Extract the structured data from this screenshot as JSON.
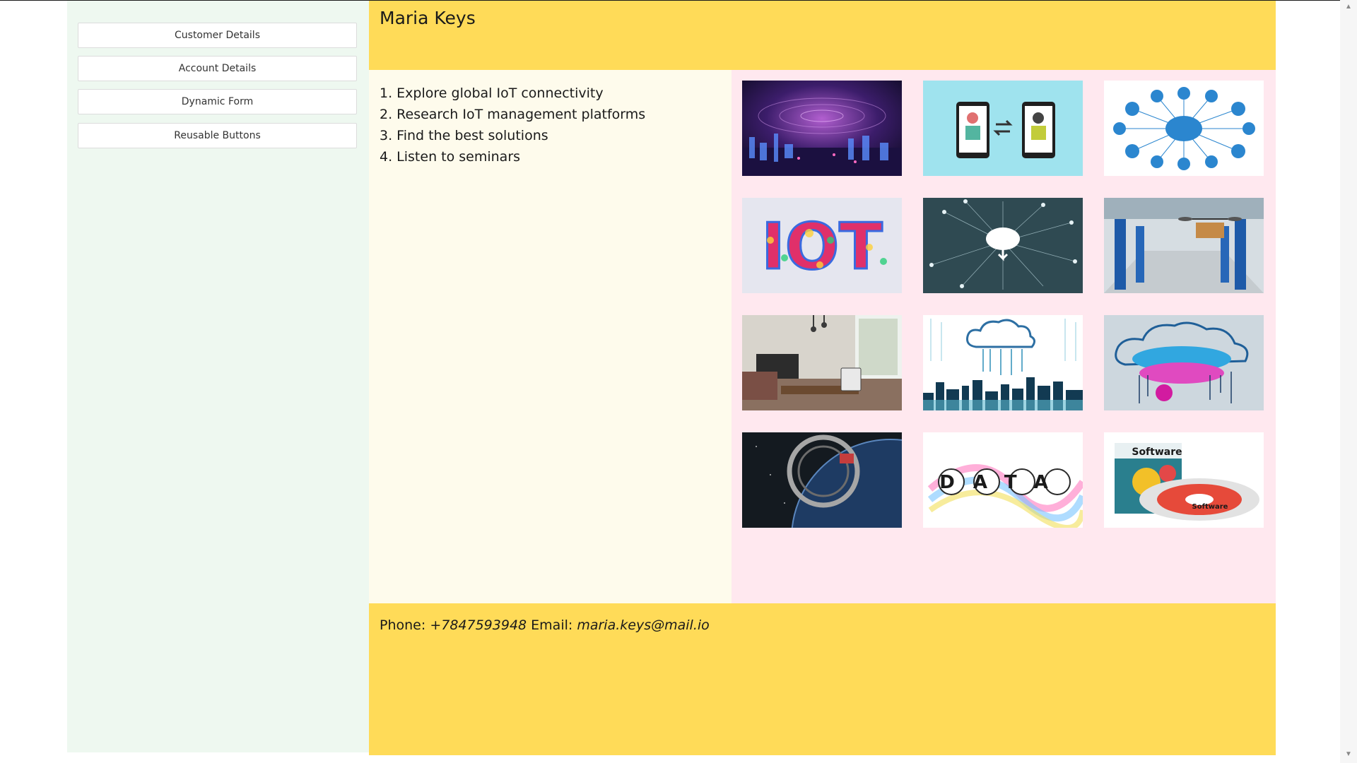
{
  "sidebar": {
    "buttons": [
      {
        "label": "Customer Details"
      },
      {
        "label": "Account Details"
      },
      {
        "label": "Dynamic Form"
      },
      {
        "label": "Reusable Buttons"
      }
    ]
  },
  "header": {
    "title": "Maria Keys"
  },
  "goals": [
    "1. Explore global IoT connectivity",
    "2. Research IoT management platforms",
    "3. Find the best solutions",
    "4. Listen to seminars"
  ],
  "gallery": {
    "images": [
      {
        "name": "city-network-image"
      },
      {
        "name": "phone-transfer-image"
      },
      {
        "name": "cloud-devices-image"
      },
      {
        "name": "iot-letters-image"
      },
      {
        "name": "cloud-network-image"
      },
      {
        "name": "drone-garage-image"
      },
      {
        "name": "smart-living-room-image"
      },
      {
        "name": "cloud-city-image"
      },
      {
        "name": "cloud-data-image"
      },
      {
        "name": "space-station-image"
      },
      {
        "name": "data-colorful-image"
      },
      {
        "name": "software-box-image"
      }
    ],
    "text": {
      "iot": "IOT",
      "data": "DATA",
      "software": "Software",
      "software_small": "Software"
    }
  },
  "footer": {
    "phone_label": "Phone:",
    "phone": "+7847593948",
    "email_label": "Email:",
    "email": "maria.keys@mail.io"
  },
  "colors": {
    "header": "#ffdb58",
    "sidebar": "#eef8f0",
    "list_panel": "#fefbec",
    "gallery": "#ffe8ef"
  }
}
